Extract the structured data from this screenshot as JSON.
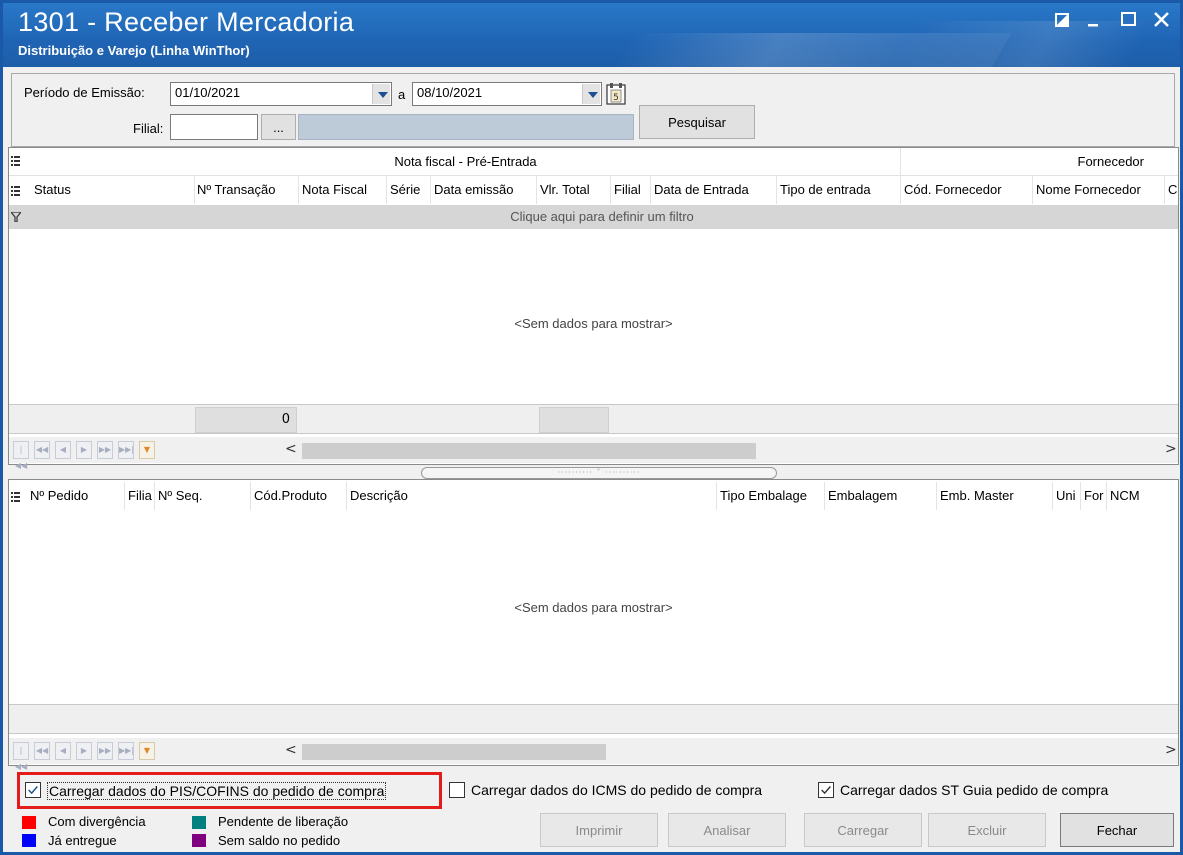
{
  "window": {
    "title": "1301 - Receber Mercadoria",
    "subtitle": "Distribuição e Varejo (Linha WinThor)"
  },
  "filters": {
    "periodo_label": "Período de Emissão:",
    "date_from": "01/10/2021",
    "to_label": "a",
    "date_to": "08/10/2021",
    "filial_label": "Filial:",
    "filial_value": "",
    "filial_lookup": "...",
    "search_button": "Pesquisar"
  },
  "grid1": {
    "group_nota": "Nota fiscal - Pré-Entrada",
    "group_fornecedor": "Fornecedor",
    "columns": [
      "Status",
      "Nº Transação",
      "Nota Fiscal",
      "Série",
      "Data emissão",
      "Vlr. Total",
      "Filial",
      "Data de Entrada",
      "Tipo de entrada",
      "Cód. Fornecedor",
      "Nome Fornecedor",
      "C"
    ],
    "filter_prompt": "Clique aqui para definir um filtro",
    "empty_text": "<Sem dados para mostrar>",
    "footer_count": "0"
  },
  "grid2": {
    "columns": [
      "Nº Pedido",
      "Filia",
      "Nº Seq.",
      "Cód.Produto",
      "Descrição",
      "Tipo Embalage",
      "Embalagem",
      "Emb. Master",
      "Uni",
      "For",
      "NCM"
    ],
    "empty_text": "<Sem dados para mostrar>"
  },
  "options": {
    "pis_cofins": {
      "label": "Carregar dados do PIS/COFINS do pedido de compra",
      "checked": true
    },
    "icms": {
      "label": "Carregar dados do ICMS do pedido de compra",
      "checked": false
    },
    "st_guia": {
      "label": "Carregar dados ST Guia pedido de compra",
      "checked": true
    }
  },
  "legend": [
    {
      "label": "Com divergência",
      "color": "#ff0000"
    },
    {
      "label": "Pendente de liberação",
      "color": "#008080"
    },
    {
      "label": "Já entregue",
      "color": "#0000ff"
    },
    {
      "label": "Sem saldo no pedido",
      "color": "#800080"
    }
  ],
  "actions": {
    "imprimir": "Imprimir",
    "analisar": "Analisar",
    "carregar": "Carregar",
    "excluir": "Excluir",
    "fechar": "Fechar"
  },
  "colors": {
    "title_bar": "#1f64b4",
    "highlight": "#e41b1b"
  },
  "icons": [
    "restore-icon",
    "minimize-icon",
    "maximize-icon",
    "close-icon",
    "dropdown-arrow-icon",
    "calendar-icon",
    "column-chooser-icon",
    "filter-icon",
    "first-record-icon",
    "prev-page-icon",
    "prev-record-icon",
    "next-record-icon",
    "next-page-icon",
    "last-record-icon"
  ]
}
